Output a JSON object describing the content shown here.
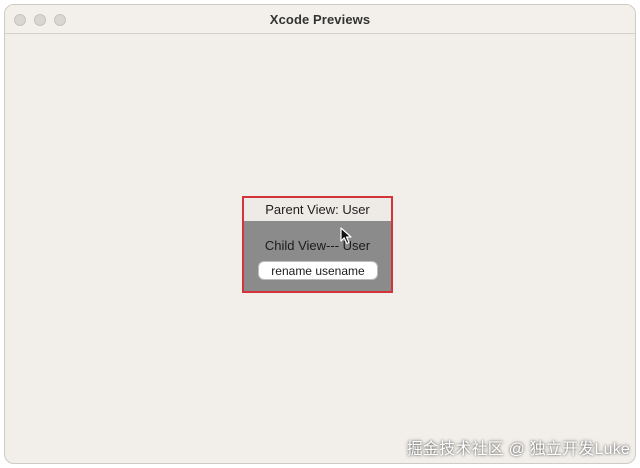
{
  "window": {
    "title": "Xcode Previews"
  },
  "preview": {
    "parent_label": "Parent View: User",
    "child_label": "Child View--- User",
    "rename_button_label": "rename usename"
  },
  "overlay": {
    "watermark": "掘金技术社区 @ 独立开发Luke"
  },
  "icons": {
    "cursor": "arrow-cursor-icon"
  },
  "colors": {
    "selection_border": "#d3343a",
    "child_background": "#8b8b8c",
    "parent_background": "#eeeae6"
  }
}
